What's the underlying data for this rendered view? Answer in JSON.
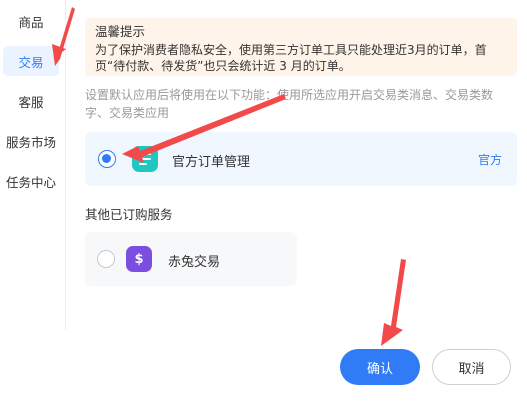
{
  "sidebar": {
    "items": [
      {
        "label": "商品"
      },
      {
        "label": "交易",
        "active": true
      },
      {
        "label": "客服"
      },
      {
        "label": "服务市场"
      },
      {
        "label": "任务中心"
      }
    ]
  },
  "notice": {
    "title": "温馨提示",
    "text": "为了保护消费者隐私安全，使用第三方订单工具只能处理近3月的订单，首页“待付款、待发货”也只会统计近 3 月的订单。"
  },
  "setting": {
    "description": "设置默认应用后将使用在以下功能：使用所选应用开启交易类消息、交易类数字、交易类应用"
  },
  "official_app": {
    "name": "官方订单管理",
    "tag": "官方",
    "selected": true,
    "icon": "order-list-icon"
  },
  "other_services": {
    "title": "其他已订购服务",
    "items": [
      {
        "name": "赤兔交易",
        "selected": false,
        "icon": "dollar-bag-icon",
        "icon_symbol": "$"
      }
    ]
  },
  "buttons": {
    "confirm": "确认",
    "cancel": "取消"
  },
  "colors": {
    "accent": "#2f7cf6",
    "notice_bg": "#fff4ea",
    "selected_card_bg": "#f1f7ff",
    "annotation_arrow": "#f24a4a"
  }
}
